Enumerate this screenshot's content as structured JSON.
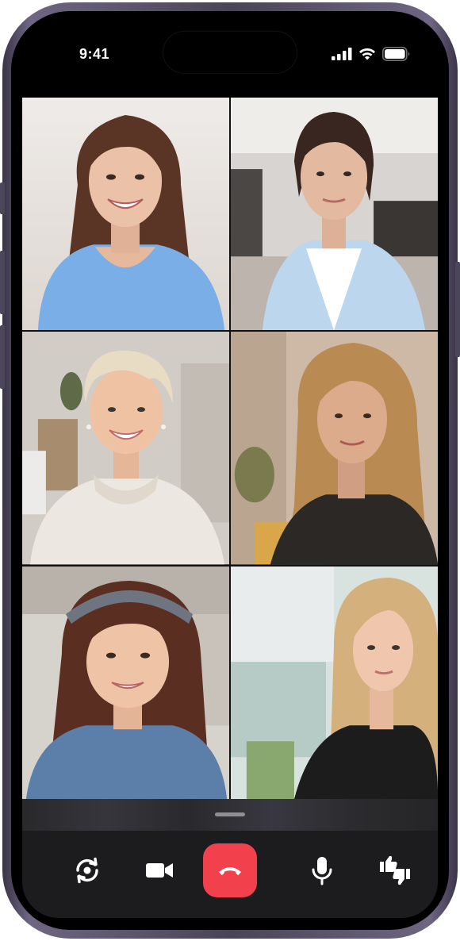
{
  "status_bar": {
    "time": "9:41",
    "icons": [
      "cellular-signal-icon",
      "wifi-icon",
      "battery-icon"
    ]
  },
  "participants": [
    {
      "name": "participant-1",
      "bg": "#e9e5e2",
      "skin": "#e8bfa5",
      "hair": "#5a3526",
      "shirt": "#7aaee6"
    },
    {
      "name": "participant-2",
      "bg": "#6a6866",
      "skin": "#e3b9a0",
      "hair": "#3a2620",
      "shirt": "#bcd6ee"
    },
    {
      "name": "participant-3",
      "bg": "#c9c3bd",
      "skin": "#efc2a4",
      "hair": "#e9dcc5",
      "shirt": "#ece7e0"
    },
    {
      "name": "participant-4",
      "bg": "#cdb9a6",
      "skin": "#dcab8c",
      "hair": "#b98a52",
      "shirt": "#2b2826"
    },
    {
      "name": "participant-5",
      "bg": "#d6d2cc",
      "skin": "#efc3a5",
      "hair": "#5a2e20",
      "shirt": "#5b7fa8"
    },
    {
      "name": "participant-6",
      "bg": "#c9d8d4",
      "skin": "#f0c7ad",
      "hair": "#d4b07c",
      "shirt": "#1c1c1c"
    }
  ],
  "controls": [
    {
      "name": "flip-camera-button",
      "icon": "flip-camera-icon"
    },
    {
      "name": "video-button",
      "icon": "video-camera-icon"
    },
    {
      "name": "end-call-button",
      "icon": "phone-hangup-icon",
      "color": "#f2404d"
    },
    {
      "name": "mute-button",
      "icon": "microphone-icon"
    },
    {
      "name": "reactions-button",
      "icon": "thumbs-up-down-icon"
    }
  ],
  "colors": {
    "panel": "#1c1c1e",
    "end_call": "#f2404d",
    "icon": "#ffffff"
  }
}
